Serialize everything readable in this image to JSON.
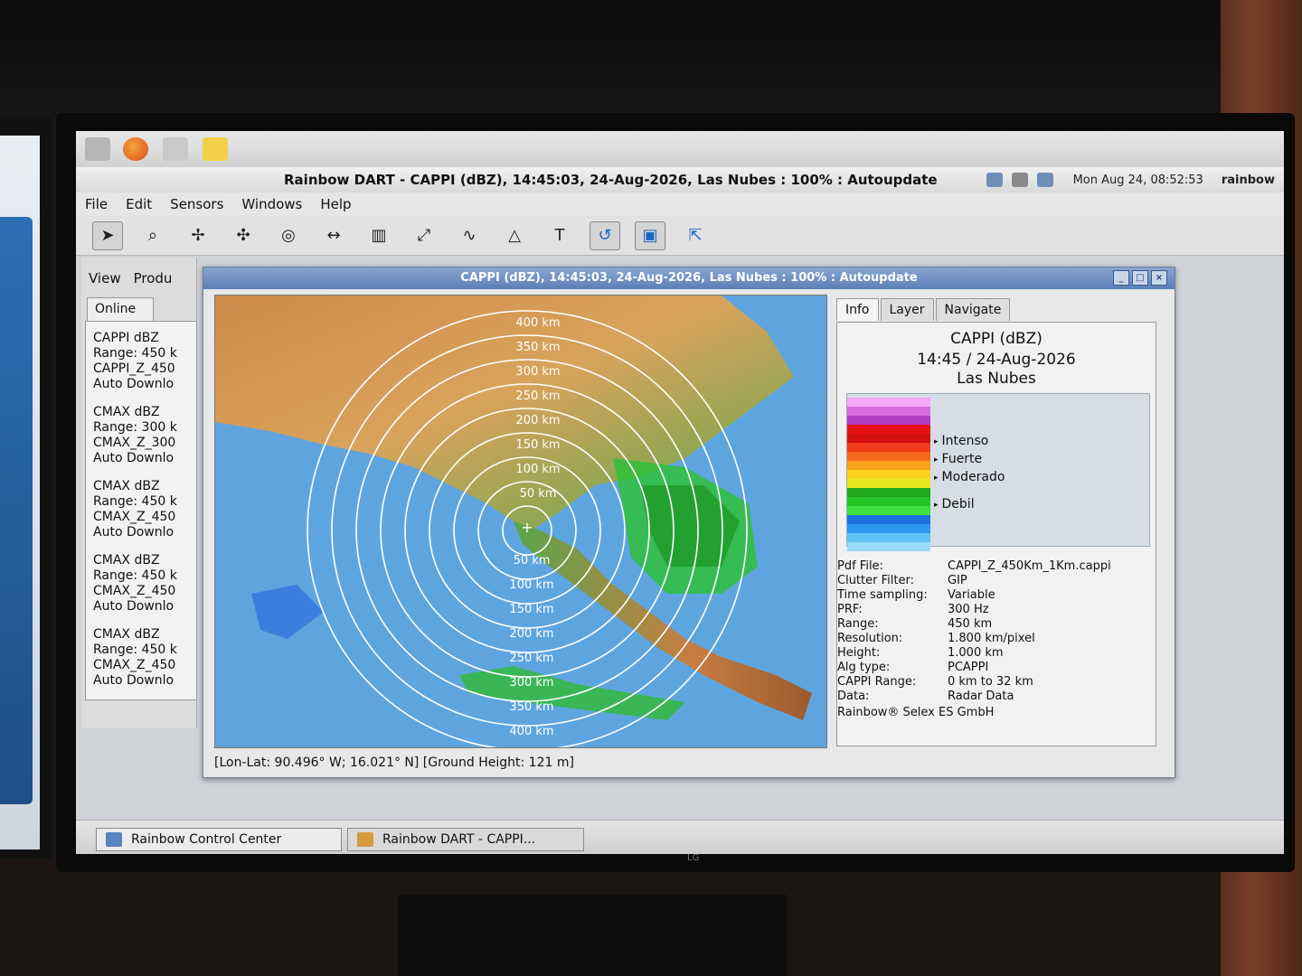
{
  "app": {
    "title": "Rainbow DART - CAPPI (dBZ), 14:45:03, 24-Aug-2026, Las Nubes : 100% : Autoupdate",
    "clock": "Mon Aug 24, 08:52:53",
    "user": "rainbow"
  },
  "menu": [
    "File",
    "Edit",
    "Sensors",
    "Windows",
    "Help"
  ],
  "toolbar": {
    "icons": [
      "pointer-icon",
      "zoom-icon",
      "move-icon",
      "center-icon",
      "target-icon",
      "measure-icon",
      "bar-icon",
      "line-icon",
      "curve-icon",
      "polygon-icon",
      "text-icon",
      "undo-icon",
      "layer-icon",
      "export-icon"
    ],
    "text_tool": "T"
  },
  "control_center": {
    "menu": [
      "View",
      "Produ"
    ],
    "tab": "Online",
    "items": [
      {
        "l1": "CAPPI dBZ",
        "l2": "Range: 450 k",
        "l3": "CAPPI_Z_450",
        "l4": "Auto Downlo"
      },
      {
        "l1": "CMAX dBZ",
        "l2": "Range: 300 k",
        "l3": "CMAX_Z_300",
        "l4": "Auto Downlo"
      },
      {
        "l1": "CMAX dBZ",
        "l2": "Range: 450 k",
        "l3": "CMAX_Z_450",
        "l4": "Auto Downlo"
      },
      {
        "l1": "CMAX dBZ",
        "l2": "Range: 450 k",
        "l3": "CMAX_Z_450",
        "l4": "Auto Downlo"
      },
      {
        "l1": "CMAX dBZ",
        "l2": "Range: 450 k",
        "l3": "CMAX_Z_450",
        "l4": "Auto Downlo"
      }
    ]
  },
  "product_window": {
    "title": "CAPPI (dBZ), 14:45:03, 24-Aug-2026, Las Nubes : 100% : Autoupdate",
    "range_labels_north": [
      "400 km",
      "350 km",
      "300 km",
      "250 km",
      "200 km",
      "150 km",
      "100 km",
      "50 km"
    ],
    "range_labels_south": [
      "50 km",
      "100 km",
      "150 km",
      "200 km",
      "250 km",
      "300 km",
      "350 km",
      "400 km"
    ],
    "status": "[Lon-Lat: 90.496° W; 16.021° N] [Ground Height: 121 m]",
    "tabs": [
      "Info",
      "Layer",
      "Navigate"
    ],
    "info": {
      "product": "CAPPI (dBZ)",
      "datetime": "14:45 / 24-Aug-2026",
      "site": "Las Nubes",
      "legend": [
        "Intenso",
        "Fuerte",
        "Moderado",
        "Debil"
      ],
      "legend_colors": [
        "#f4a6f8",
        "#d86de0",
        "#b03cc2",
        "#e81212",
        "#d61010",
        "#f23a1c",
        "#f56a1a",
        "#f7a21b",
        "#fad21c",
        "#e7e81e",
        "#1ea81e",
        "#25c425",
        "#3fe03f",
        "#1e6fe0",
        "#2f98f0",
        "#62c3f5",
        "#9adcf8"
      ],
      "meta": [
        {
          "k": "Pdf File:",
          "v": "CAPPI_Z_450Km_1Km.cappi"
        },
        {
          "k": "Clutter Filter:",
          "v": "GIP"
        },
        {
          "k": "Time sampling:",
          "v": "Variable"
        },
        {
          "k": "PRF:",
          "v": "300 Hz"
        },
        {
          "k": "Range:",
          "v": "450 km"
        },
        {
          "k": "Resolution:",
          "v": "1.800 km/pixel"
        },
        {
          "k": "Height:",
          "v": "1.000 km"
        },
        {
          "k": "Alg type:",
          "v": "PCAPPI"
        },
        {
          "k": "CAPPI Range:",
          "v": "0 km to 32 km"
        },
        {
          "k": "Data:",
          "v": "Radar Data"
        }
      ],
      "footer": "Rainbow® Selex ES GmbH"
    }
  },
  "taskbar": {
    "tasks": [
      "Rainbow Control Center",
      "Rainbow DART - CAPPI..."
    ]
  },
  "colors": {
    "ocean": "#5aa3e0",
    "land_low": "#4fa64a",
    "land_high": "#c9763a",
    "title_bar": "#5b7fb8",
    "ring": "#ffffff"
  }
}
